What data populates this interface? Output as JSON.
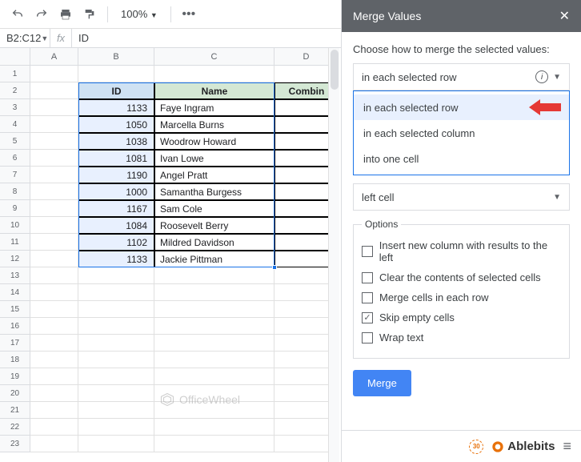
{
  "toolbar": {
    "zoom": "100%"
  },
  "formula": {
    "cell_ref": "B2:C12",
    "fx": "fx",
    "value": "ID"
  },
  "columns": [
    "A",
    "B",
    "C",
    "D"
  ],
  "table": {
    "headers": {
      "id": "ID",
      "name": "Name",
      "combined": "Combin"
    },
    "rows": [
      {
        "id": "1133",
        "name": "Faye Ingram"
      },
      {
        "id": "1050",
        "name": "Marcella Burns"
      },
      {
        "id": "1038",
        "name": "Woodrow Howard"
      },
      {
        "id": "1081",
        "name": "Ivan Lowe"
      },
      {
        "id": "1190",
        "name": "Angel Pratt"
      },
      {
        "id": "1000",
        "name": "Samantha Burgess"
      },
      {
        "id": "1167",
        "name": "Sam Cole"
      },
      {
        "id": "1084",
        "name": "Roosevelt Berry"
      },
      {
        "id": "1102",
        "name": "Mildred Davidson"
      },
      {
        "id": "1133",
        "name": "Jackie Pittman"
      }
    ]
  },
  "panel": {
    "title": "Merge Values",
    "prompt": "Choose how to merge the selected values:",
    "merge_select": "in each selected row",
    "dd_opts": [
      "in each selected row",
      "in each selected column",
      "into one cell"
    ],
    "place_select": "left cell",
    "options_legend": "Options",
    "chk1": "Insert new column with results to the left",
    "chk2": "Clear the contents of selected cells",
    "chk3": "Merge cells in each row",
    "chk4": "Skip empty cells",
    "chk5": "Wrap text",
    "merge_btn": "Merge",
    "footer_brand": "Ablebits",
    "badge": "30"
  },
  "watermark": "OfficeWheel",
  "row_numbers": [
    "1",
    "2",
    "3",
    "4",
    "5",
    "6",
    "7",
    "8",
    "9",
    "10",
    "11",
    "12",
    "13",
    "14",
    "15",
    "16",
    "17",
    "18",
    "19",
    "20",
    "21",
    "22",
    "23"
  ]
}
